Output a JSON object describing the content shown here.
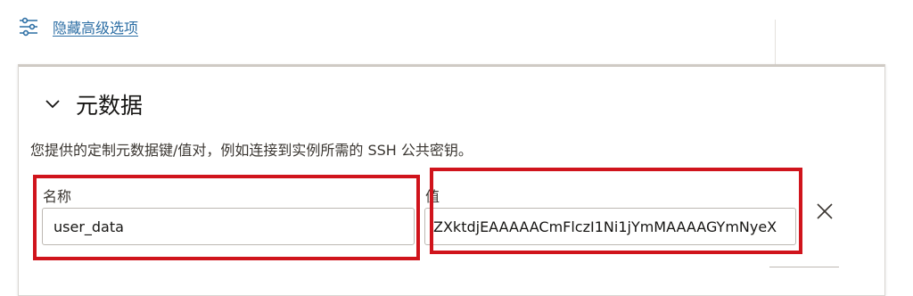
{
  "advanced": {
    "toggle_label": "隐藏高级选项",
    "icon": "sliders-icon"
  },
  "metadata": {
    "title": "元数据",
    "description": "您提供的定制元数据键/值对，例如连接到实例所需的 SSH 公共密钥。",
    "name_label": "名称",
    "value_label": "值",
    "name_value": "user_data",
    "value_value": "ZXktdjEAAAAACmFlczI1Ni1jYmMAAAAGYmNyeX"
  },
  "colors": {
    "link": "#2c6ea4",
    "highlight": "#d0141c"
  }
}
